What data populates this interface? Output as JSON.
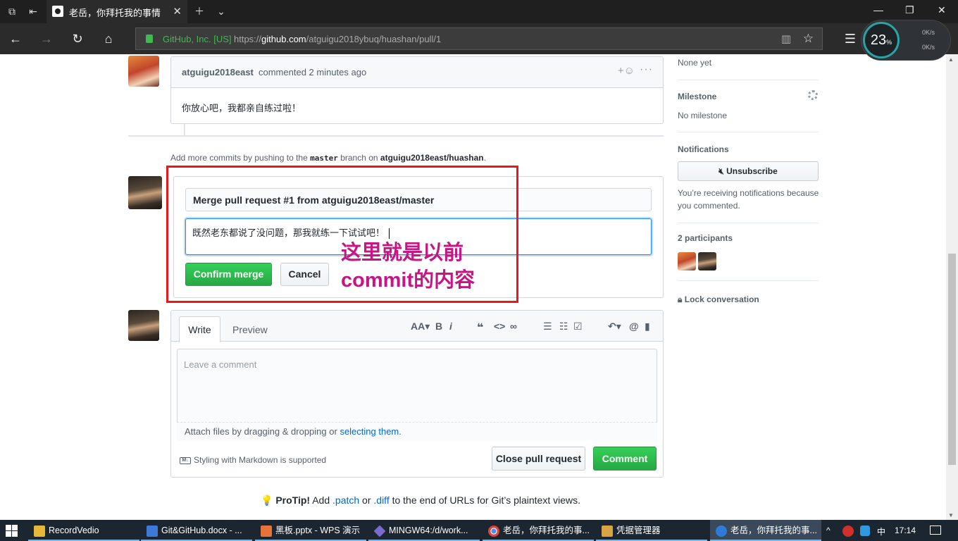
{
  "browser": {
    "tab_title": "老岳，你拜托我的事情",
    "site_identity": "GitHub, Inc. [US]",
    "url_prefix": "https://",
    "url_domain": "github.com",
    "url_path": "/atguigu2018ybuq/huashan/pull/1",
    "net_monitor": {
      "percent": "23",
      "percent_unit": "%",
      "up": "0K/s",
      "down": "0K/s"
    }
  },
  "comment": {
    "author": "atguigu2018east",
    "meta": "commented 2 minutes ago",
    "body": "你放心吧，我都亲自练过啦！"
  },
  "commit_hint": {
    "prefix": "Add more commits by pushing to the",
    "branch": "master",
    "middle": "branch on",
    "repo": "atguigu2018east/huashan",
    "suffix": "."
  },
  "merge": {
    "title": "Merge pull request #1 from atguigu2018east/master",
    "message": "既然老东都说了没问题，那我就练一下试试吧！",
    "confirm_label": "Confirm merge",
    "cancel_label": "Cancel"
  },
  "annotation": {
    "line1": "这里就是以前",
    "line2": "commit的内容",
    "color": "#c71585",
    "frame_color": "#e6191c"
  },
  "editor": {
    "tab_write": "Write",
    "tab_preview": "Preview",
    "placeholder": "Leave a comment",
    "attach_prefix": "Attach files by dragging & dropping or",
    "attach_link": "selecting them",
    "attach_suffix": ".",
    "markdown_note": "Styling with Markdown is supported",
    "close_label": "Close pull request",
    "comment_label": "Comment"
  },
  "protip": {
    "label": "ProTip!",
    "t1": "Add",
    "l1": ".patch",
    "t2": "or",
    "l2": ".diff",
    "t3": "to the end of URLs for Git’s plaintext views."
  },
  "sidebar": {
    "none_yet": "None yet",
    "milestone_head": "Milestone",
    "milestone_value": "No milestone",
    "notifications_head": "Notifications",
    "unsubscribe_label": "Unsubscribe",
    "notify_reason": "You’re receiving notifications because you commented.",
    "participants_head": "2 participants",
    "lock_label": "Lock conversation"
  },
  "taskbar": {
    "items": [
      "RecordVedio",
      "Git&GitHub.docx - ...",
      "黑板.pptx - WPS 演示",
      "MINGW64:/d/work...",
      "老岳，你拜托我的事...",
      "凭据管理器",
      "老岳，你拜托我的事..."
    ],
    "ime": "中",
    "time": "17:14"
  },
  "colors": {
    "accent_green": "#28a745",
    "link_blue": "#0366d6"
  }
}
